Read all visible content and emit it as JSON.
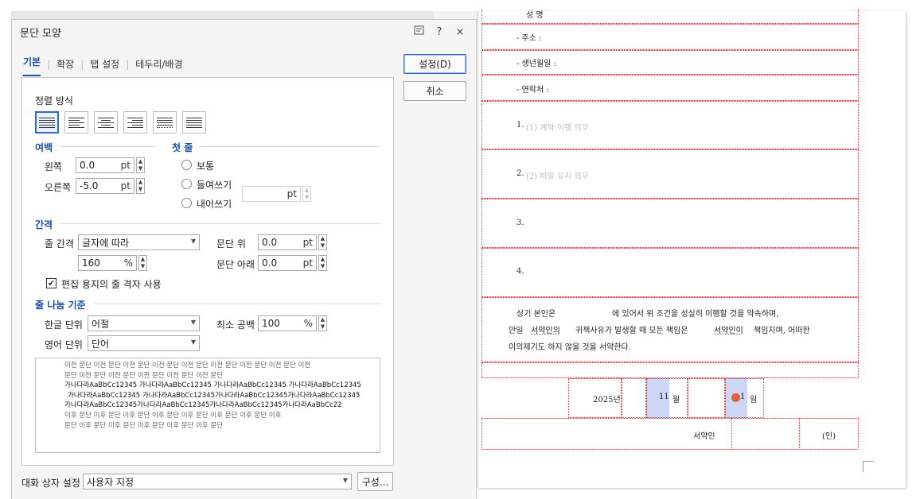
{
  "dialog": {
    "title": "문단 모양",
    "tabs": [
      "기본",
      "확장",
      "탭 설정",
      "테두리/배경"
    ],
    "ok_label": "설정(D)",
    "cancel_label": "취소",
    "icon_names": [
      "save-preset-icon",
      "help-icon",
      "close-icon"
    ],
    "help_label": "?",
    "close_label": "×"
  },
  "align": {
    "label": "정렬 방식",
    "options": [
      "justify",
      "left",
      "center",
      "right",
      "distribute",
      "divide"
    ],
    "selected": "justify"
  },
  "margin": {
    "label": "여백",
    "left_label": "왼쪽",
    "left_value": "0.0",
    "right_label": "오른쪽",
    "right_value": "-5.0",
    "unit": "pt"
  },
  "first_line": {
    "label": "첫 줄",
    "options": [
      "보통",
      "들여쓰기",
      "내어쓰기"
    ],
    "value_unit": "pt"
  },
  "spacing": {
    "label": "간격",
    "line_label": "줄 간격",
    "line_mode": "글자에 따라",
    "line_value": "160",
    "line_unit": "%",
    "above_label": "문단 위",
    "above_value": "0.0",
    "below_label": "문단 아래",
    "below_value": "0.0",
    "unit": "pt",
    "grid_label": "편집 용지의 줄 격자 사용",
    "grid_checked": true
  },
  "break": {
    "label": "줄 나눔 기준",
    "hangul_label": "한글 단위",
    "hangul_value": "어절",
    "english_label": "영어 단위",
    "english_value": "단어",
    "min_space_label": "최소 공백",
    "min_space_value": "100",
    "min_space_unit": "%"
  },
  "preview": {
    "prev_lines": [
      "이전 문단 이전 문단 이전 문단 이전 문단 이전 문단 이전 문단 이전 문단 이전 문단 이전",
      "문단 이전 문단 이전 문단 이전 문단 이전 문단 이전 문단"
    ],
    "cur_lines": [
      "가나다라AaBbCc12345 가나다라AaBbCc12345 가나다라AaBbCc12345 가나다라AaBbCc12345",
      "가나다라AaBbCc12345 가나다라AaBbCc12345가나다라AaBbCc12345가나다라AaBbCc12345",
      "가나다라AaBbCc12345가나다라AaBbCc12345가나다라AaBbCc12345가나다라AaBbCc22"
    ],
    "next_lines": [
      "이후 문단 이후 문단 이후 문단 이후 문단 이후 문단 이후 문단 이후 문단 이후",
      "문단 이후 문단 이후 문단 이후 문단 이후 문단 이후 문단"
    ]
  },
  "footer": {
    "label": "대화 상자 설정",
    "value": "사용자 지정",
    "config_label": "구성..."
  },
  "document": {
    "top_cut": "성 명",
    "rows": [
      "- 주소 :",
      "- 생년월일 :",
      "- 연락처 :"
    ],
    "items": [
      "1.",
      "(1) 계약 이행 의무",
      "2.",
      "(2) 비밀 유지 의무",
      "3.",
      "4."
    ],
    "paragraph": [
      "상기 본인은",
      "에 있어서 위 조건을 성실히 이행할 것을 약속하며,",
      "만일",
      "서약인의",
      "귀책사유가 발생할 때 모든 책임은",
      "서약인이",
      "책임지며, 어떠한",
      "이의제기도 하지 않을 것을 서약한다."
    ],
    "year": "2025년",
    "month_num": "11",
    "month": "월",
    "day_num": "1",
    "day": "일",
    "signer": "서약인",
    "seal": "(인)"
  }
}
